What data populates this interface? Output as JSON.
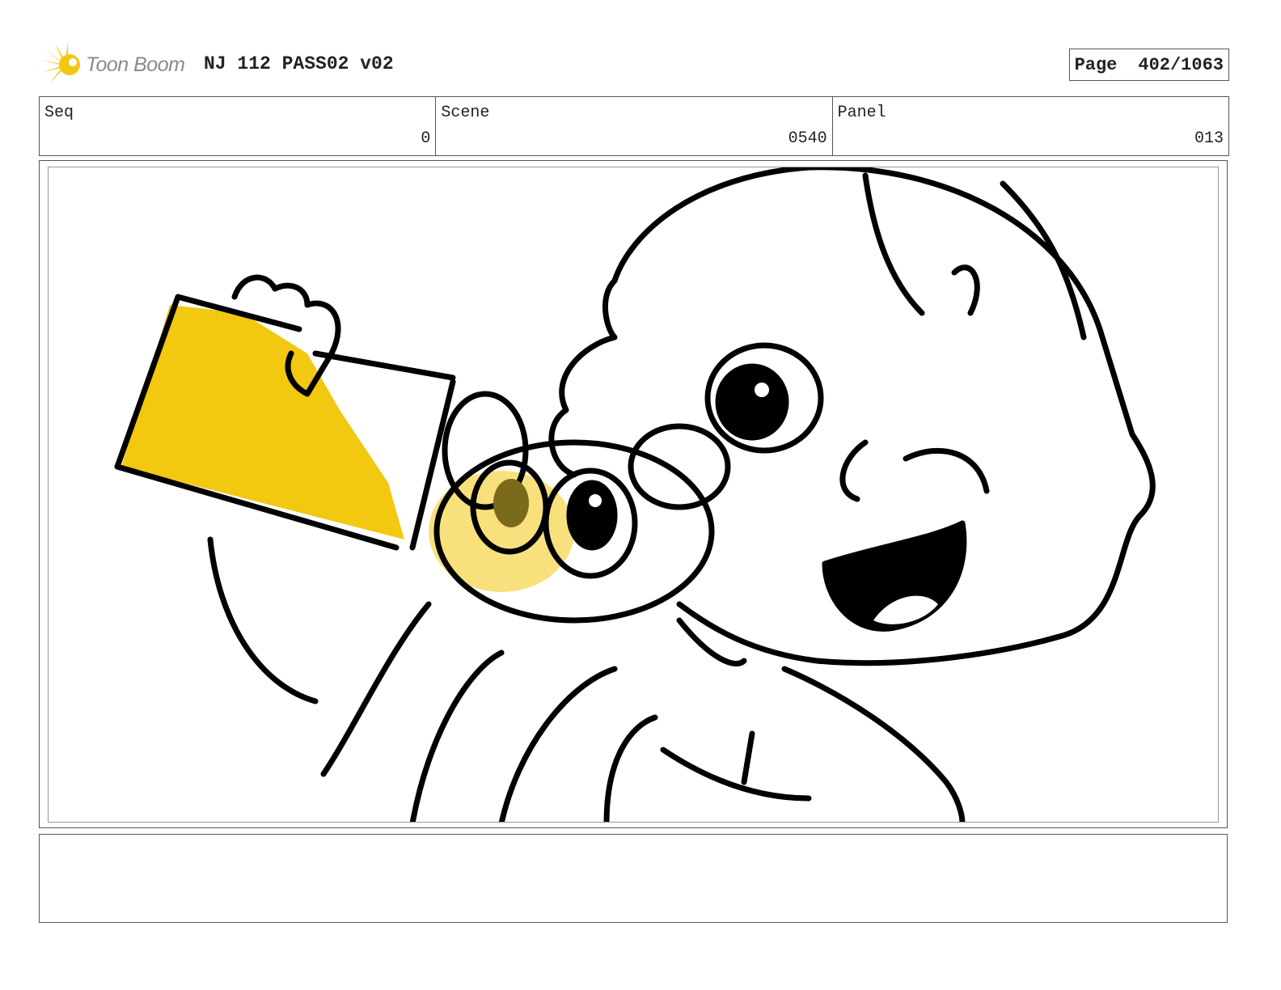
{
  "header": {
    "logo_text": "Toon Boom",
    "project_title": "NJ 112 PASS02 v02",
    "page_label": "Page",
    "page_number": "402/1063"
  },
  "info": {
    "seq_label": "Seq",
    "seq_value": "0",
    "scene_label": "Scene",
    "scene_value": "0540",
    "panel_label": "Panel",
    "panel_value": "013"
  },
  "colors": {
    "accent_yellow": "#f2c811",
    "line": "#000000",
    "border": "#555555"
  },
  "notes": {
    "text": ""
  }
}
